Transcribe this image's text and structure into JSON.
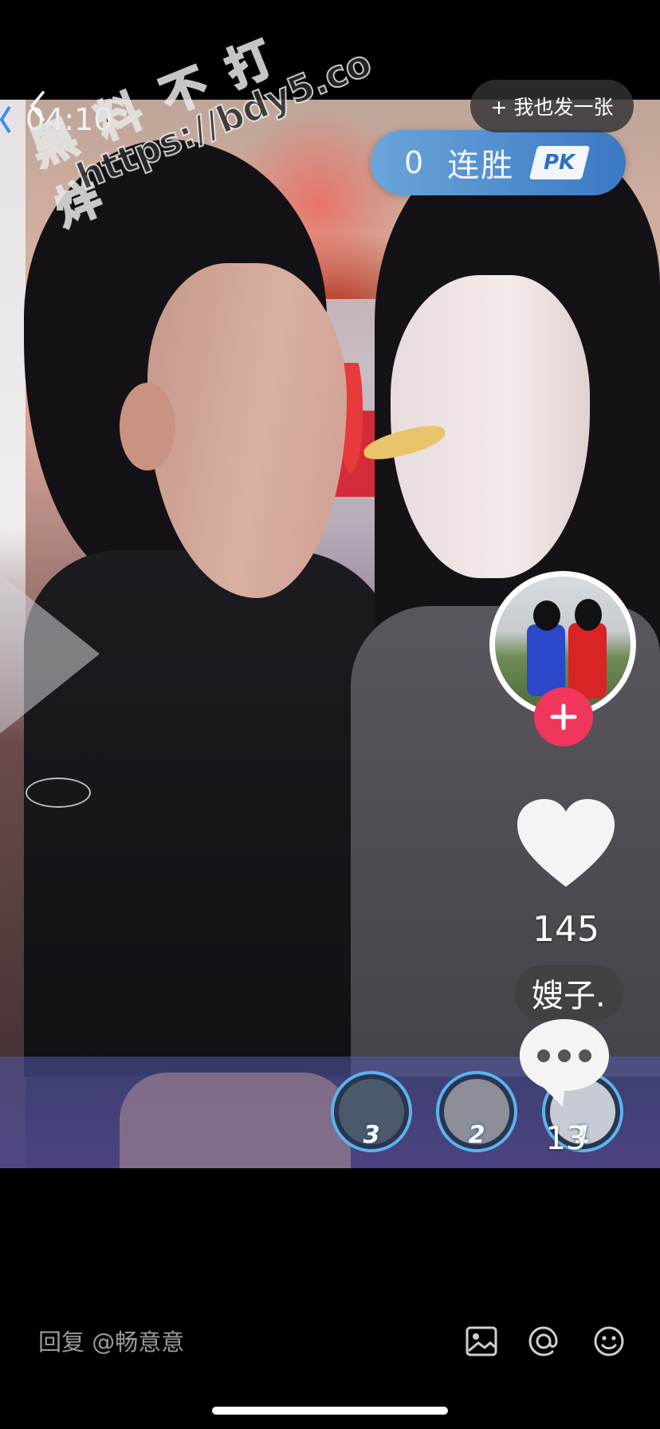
{
  "header": {
    "timer": "04:10",
    "post_button_label": "+ 我也发一张"
  },
  "pk_banner": {
    "count": "0",
    "label": "连胜",
    "badge": "PK"
  },
  "watermark": {
    "line1": "黑料不打烊",
    "line2": "https://bdy5.co"
  },
  "right_rail": {
    "like_count": "145",
    "nickname": "嫂子.",
    "comment_count": "13"
  },
  "rank_bar": {
    "avatars": [
      {
        "rank": "3",
        "color": "#4a5a6a"
      },
      {
        "rank": "2",
        "color": "#8c8f9a"
      },
      {
        "rank": "1",
        "color": "#c7cbd4"
      }
    ]
  },
  "reply": {
    "placeholder": "回复 @畅意意"
  },
  "colors": {
    "pk_blue": "#3b78c4",
    "follow_red": "#f0365a"
  },
  "icons": [
    "back-icon",
    "image-icon",
    "at-icon",
    "emoji-icon",
    "heart-icon",
    "comment-icon",
    "plus-icon"
  ]
}
